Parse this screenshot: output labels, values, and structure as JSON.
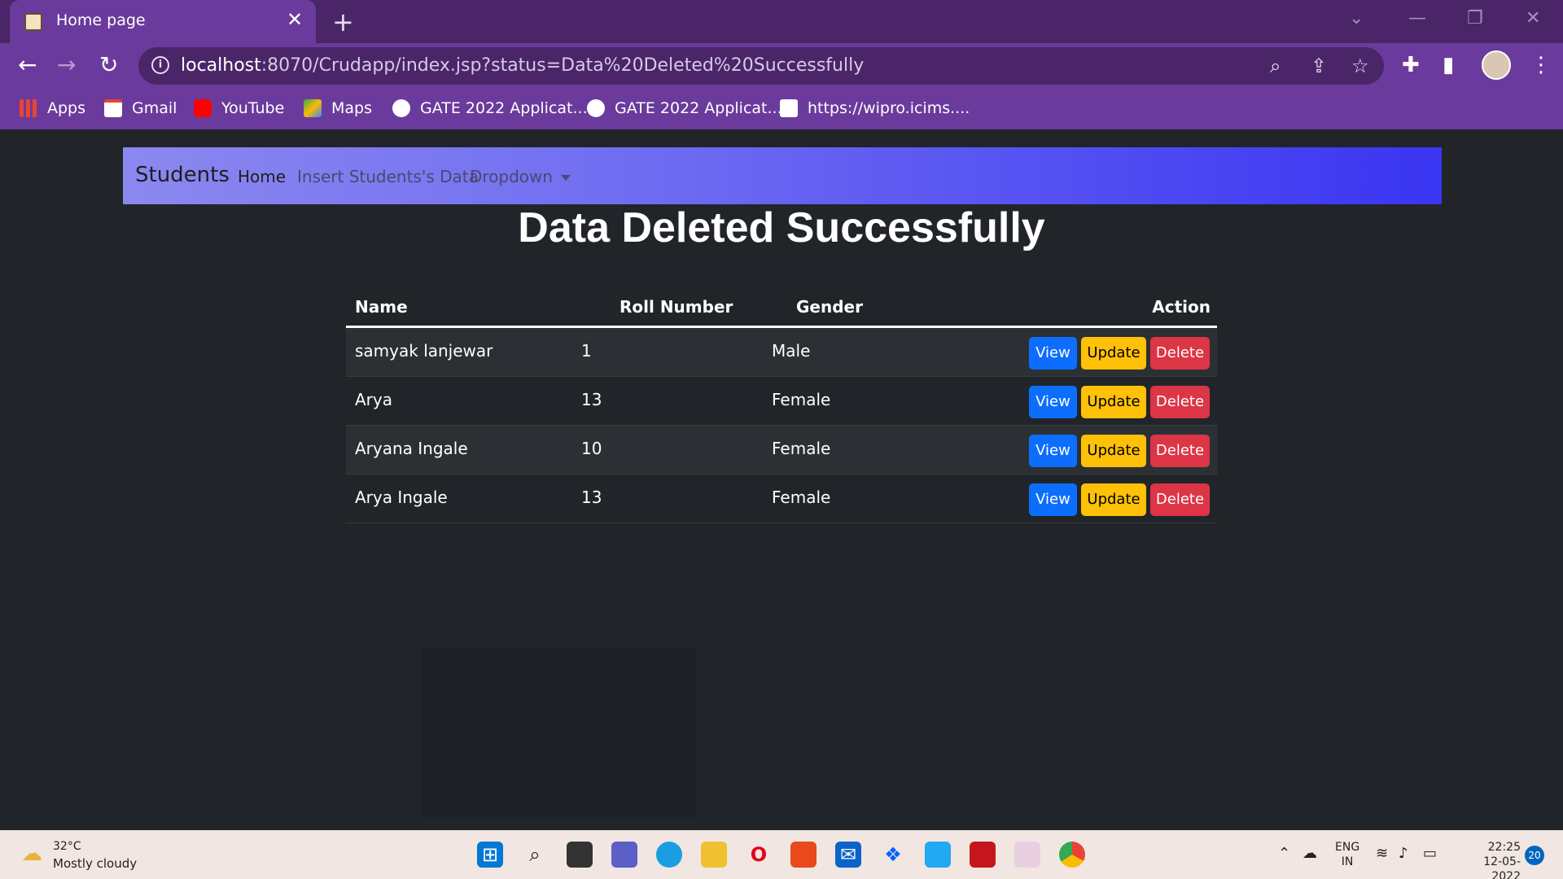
{
  "browser": {
    "tab_title": "Home page",
    "close_glyph": "✕",
    "new_tab_glyph": "+",
    "window_controls": [
      "⌄",
      "—",
      "❐",
      "✕"
    ],
    "url_host": "localhost",
    "url_rest": ":8070/Crudapp/index.jsp?status=Data%20Deleted%20Successfully",
    "back_glyph": "←",
    "forward_glyph": "→",
    "reload_glyph": "↻",
    "bookmarks": [
      {
        "label": "Apps",
        "icon": "apps-grid-icon",
        "color": "#ea4335"
      },
      {
        "label": "Gmail",
        "icon": "gmail-icon",
        "color": "#ea4335"
      },
      {
        "label": "YouTube",
        "icon": "youtube-icon",
        "color": "#ff0000"
      },
      {
        "label": "Maps",
        "icon": "maps-icon",
        "color": "#34a853"
      },
      {
        "label": "GATE 2022 Applicat...",
        "icon": "globe-icon",
        "color": "#ffffff"
      },
      {
        "label": "GATE 2022 Applicat...",
        "icon": "globe-icon",
        "color": "#ffffff"
      },
      {
        "label": "https://wipro.icims....",
        "icon": "wipro-icon",
        "color": "#ffffff"
      }
    ]
  },
  "navbar": {
    "brand": "Students",
    "home": "Home",
    "insert": "Insert Students's Data",
    "dropdown": "Dropdown"
  },
  "page": {
    "heading": "Data Deleted Successfully"
  },
  "table": {
    "headers": {
      "name": "Name",
      "roll": "Roll Number",
      "gender": "Gender",
      "action": "Action"
    },
    "rows": [
      {
        "name": "samyak lanjewar",
        "roll": "1",
        "gender": "Male"
      },
      {
        "name": "Arya",
        "roll": "13",
        "gender": "Female"
      },
      {
        "name": "Aryana Ingale",
        "roll": "10",
        "gender": "Female"
      },
      {
        "name": "Arya Ingale",
        "roll": "13",
        "gender": "Female"
      }
    ],
    "buttons": {
      "view": "View",
      "update": "Update",
      "delete": "Delete"
    }
  },
  "taskbar": {
    "temperature": "32°C",
    "weather": "Mostly cloudy",
    "lang_line1": "ENG",
    "lang_line2": "IN",
    "time": "22:25",
    "date": "12-05-2022",
    "notifications": "20"
  },
  "colors": {
    "view": "#0d6efd",
    "update": "#ffc107",
    "delete": "#dc3545",
    "page_bg": "#212529",
    "browser_accent": "#6a3b9c"
  }
}
